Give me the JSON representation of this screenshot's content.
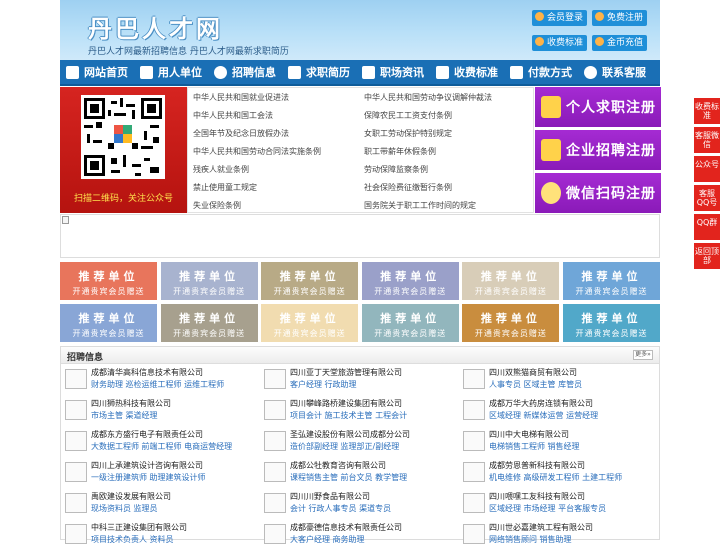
{
  "header": {
    "logo": "丹巴人才网",
    "slogan": "丹巴人才网最新招聘信息   丹巴人才网最新求职简历",
    "buttons": [
      "会员登录",
      "免费注册",
      "收费标准",
      "金币充值"
    ]
  },
  "nav": [
    "网站首页",
    "用人单位",
    "招聘信息",
    "求职简历",
    "职场资讯",
    "收费标准",
    "付款方式",
    "联系客服"
  ],
  "qr": {
    "caption": "扫描二维码，关注公众号"
  },
  "links": [
    "中华人民共和国就业促进法",
    "中华人民共和国劳动争议调解仲裁法",
    "中华人民共和国工会法",
    "保障农民工工资支付条例",
    "全国年节及纪念日放假办法",
    "女职工劳动保护特别规定",
    "中华人民共和国劳动合同法实施条例",
    "职工带薪年休假条例",
    "残疾人就业条例",
    "劳动保障监察条例",
    "禁止使用童工规定",
    "社会保险费征缴暂行条例",
    "失业保险条例",
    "国务院关于职工工作时间的规定"
  ],
  "register": [
    "个人求职注册",
    "企业招聘注册",
    "微信扫码注册"
  ],
  "tiles": {
    "title": "推荐单位",
    "sub": "开通贵宾会员赠送",
    "colors": [
      "#e8755c",
      "#a8b3cf",
      "#b8aa86",
      "#9aa0c9",
      "#d8cdb8",
      "#6fa6d8",
      "#89a6d6",
      "#a7a08e",
      "#f1dcb0",
      "#92b6bd",
      "#c98d3e",
      "#51a8c9"
    ]
  },
  "jobs": {
    "title": "招聘信息",
    "more": "更多»",
    "items": [
      {
        "company": "成都清华高科信息技术有限公司",
        "positions": "财务助理 巡检运维工程师 运维工程师"
      },
      {
        "company": "四川亚丁天堂旅游管理有限公司",
        "positions": "客户经理 行政助理"
      },
      {
        "company": "四川双熊猫商贸有限公司",
        "positions": "人事专员 区域主管 库管员"
      },
      {
        "company": "四川狮热科技有限公司",
        "positions": "市场主管 渠道经理"
      },
      {
        "company": "四川攀峰路桥建设集团有限公司",
        "positions": "项目会计 施工技术主管 工程会计"
      },
      {
        "company": "成都万华大药房连锁有限公司",
        "positions": "区域经理 新媒体运营 运营经理"
      },
      {
        "company": "成都东方盛行电子有限责任公司",
        "positions": "大数据工程师 前端工程师 电商运营经理"
      },
      {
        "company": "圣弘建设股份有限公司成都分公司",
        "positions": "造价部副经理 监理部正/副经理"
      },
      {
        "company": "四川中大电梯有限公司",
        "positions": "电梯销售工程师 销售经理"
      },
      {
        "company": "四川上承建筑设计咨询有限公司",
        "positions": "一级注册建筑师 助理建筑设计师"
      },
      {
        "company": "成都公牡教育咨询有限公司",
        "positions": "课程销售主管 前台文员 教学管理"
      },
      {
        "company": "成都劳恩普新科技有限公司",
        "positions": "机电维修 高级研发工程师 土建工程师"
      },
      {
        "company": "禹欧建设发展有限公司",
        "positions": "现场资料员 监理员"
      },
      {
        "company": "四川川野食品有限公司",
        "positions": "会计 行政人事专员 渠道专员"
      },
      {
        "company": "四川喂嘿工友科技有限公司",
        "positions": "区域经理 市场经理 平台客服专员"
      },
      {
        "company": "中科三正建设集团有限公司",
        "positions": "项目技术负责人 资料员"
      },
      {
        "company": "成都豪德信息技术有限责任公司",
        "positions": "大客户经理 商务助理"
      },
      {
        "company": "四川世必嘉建筑工程有限公司",
        "positions": "网络销售顾问 销售助理"
      }
    ]
  },
  "float": [
    "收费标准",
    "客服微信",
    "公众号",
    "客服QQ号",
    "QQ群",
    "返回顶部"
  ]
}
